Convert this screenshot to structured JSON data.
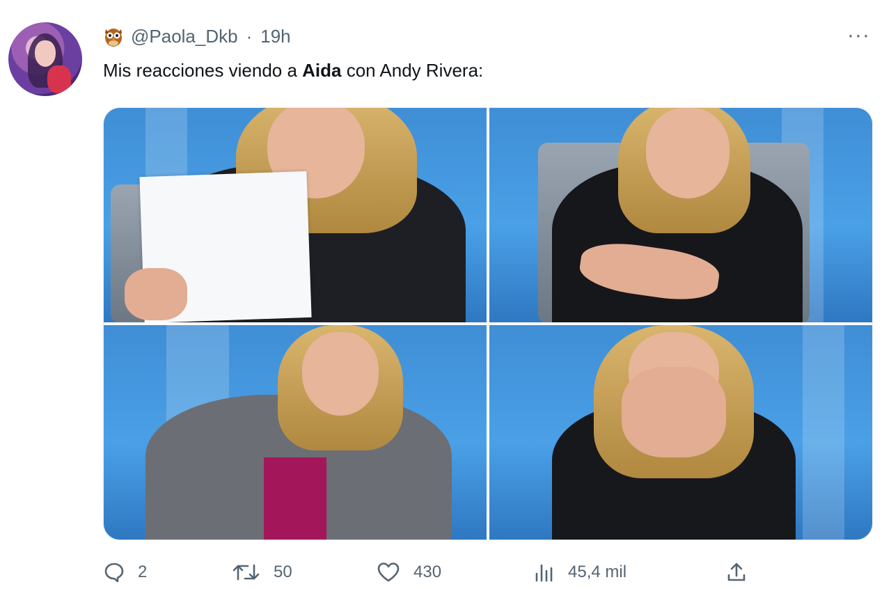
{
  "tweet": {
    "handle": "@Paola_Dkb",
    "separator": "·",
    "time": "19h",
    "text_pre": "Mis reacciones viendo a ",
    "text_bold": "Aida",
    "text_post": " con Andy Rivera:",
    "more": "···"
  },
  "actions": {
    "replies": "2",
    "retweets": "50",
    "likes": "430",
    "views": "45,4 mil"
  },
  "icons": {
    "badge": "owl-emoji-icon",
    "reply": "reply-icon",
    "retweet": "retweet-icon",
    "like": "heart-icon",
    "views": "views-chart-icon",
    "share": "share-icon",
    "more": "more-options-icon"
  },
  "colors": {
    "secondary_text": "#536471",
    "primary_text": "#0f1419",
    "studio_blue": "#4aa0e6"
  }
}
